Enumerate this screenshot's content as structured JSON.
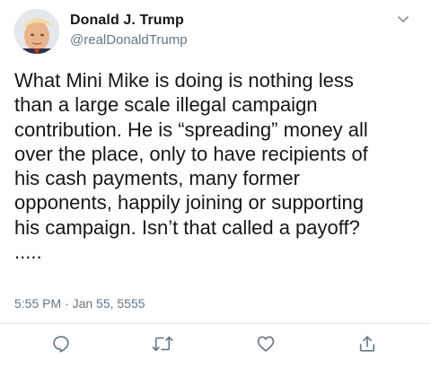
{
  "tweet": {
    "author_name": "Donald J. Trump",
    "author_handle": "@realDonaldTrump",
    "text": "What Mini Mike is doing is nothing less\nthan a large scale illegal campaign\ncontribution. He is “spreading” money all\nover the place, only to have recipients of\nhis cash payments, many former\nopponents, happily joining or supporting\nhis campaign. Isn’t that called a payoff?\n.....",
    "timestamp": "5:55 PM · Jan 55, 5555"
  },
  "icons": {
    "avatar": "profile-photo",
    "menu": "chevron-down-icon",
    "reply": "reply-icon",
    "retweet": "retweet-icon",
    "like": "heart-icon",
    "share": "share-icon"
  },
  "colors": {
    "text": "#14171a",
    "secondary": "#657786",
    "icon": "#657786",
    "divider": "#e6ecf0"
  }
}
